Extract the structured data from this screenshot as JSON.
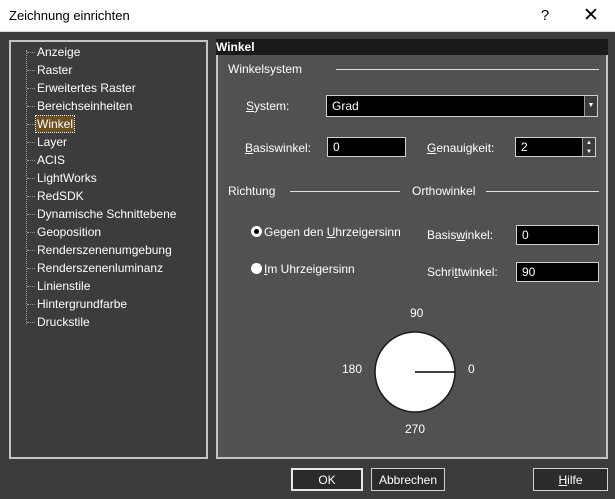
{
  "window": {
    "title": "Zeichnung einrichten",
    "help_glyph": "?",
    "close_glyph": "✕"
  },
  "tree": {
    "items": [
      {
        "label": "Anzeige"
      },
      {
        "label": "Raster"
      },
      {
        "label": "Erweitertes Raster"
      },
      {
        "label": "Bereichseinheiten"
      },
      {
        "label": "Winkel",
        "selected": true
      },
      {
        "label": "Layer"
      },
      {
        "label": "ACIS"
      },
      {
        "label": "LightWorks"
      },
      {
        "label": "RedSDK"
      },
      {
        "label": "Dynamische Schnittebene"
      },
      {
        "label": "Geoposition"
      },
      {
        "label": "Renderszenenumgebung"
      },
      {
        "label": "Renderszenenluminanz"
      },
      {
        "label": "Linienstile"
      },
      {
        "label": "Hintergrundfarbe"
      },
      {
        "label": "Druckstile"
      }
    ]
  },
  "page": {
    "title": "Winkel",
    "angle_system": {
      "section_label": "Winkelsystem",
      "system": {
        "pre": "",
        "key": "S",
        "post": "ystem:",
        "value": "Grad"
      },
      "base_angle": {
        "pre": "",
        "key": "B",
        "post": "asiswinkel:",
        "value": "0"
      },
      "precision": {
        "pre": "",
        "key": "G",
        "post": "enauigkeit:",
        "value": "2"
      }
    },
    "direction": {
      "section_label": "Richtung",
      "ccw": {
        "pre": "Gegen den ",
        "key": "U",
        "post": "hrzeigersinn",
        "selected": true
      },
      "cw": {
        "pre": "",
        "key": "I",
        "post": "m Uhrzeigersinn",
        "selected": false
      }
    },
    "ortho": {
      "section_label": "Orthowinkel",
      "base_angle": {
        "pre": "Basis",
        "key": "w",
        "post": "inkel:",
        "value": "0"
      },
      "step_angle": {
        "pre": "Schri",
        "key": "t",
        "post": "twinkel:",
        "value": "90"
      }
    },
    "dial": {
      "label_top": "90",
      "label_left": "180",
      "label_right": "0",
      "label_bottom": "270",
      "needle_angle_deg": 0
    }
  },
  "buttons": {
    "ok": "OK",
    "cancel": "Abbrechen",
    "help": {
      "pre": "",
      "key": "H",
      "post": "ilfe"
    }
  },
  "colors": {
    "selection": "#6b5020",
    "background": "#3c3c3c",
    "panel": "#515151"
  }
}
